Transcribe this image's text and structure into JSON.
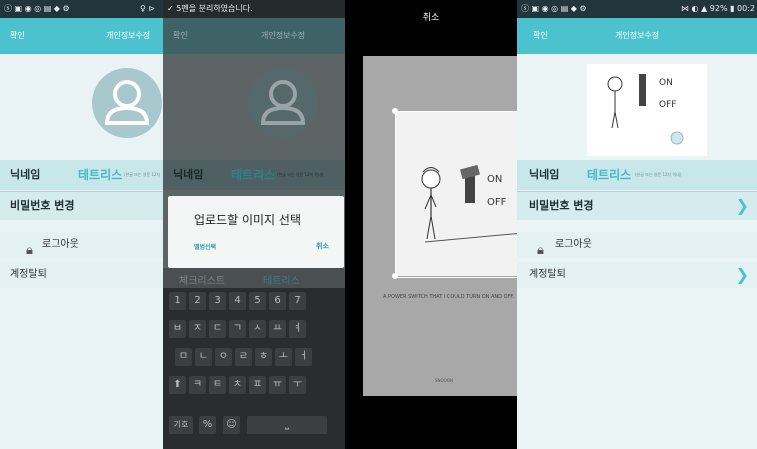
{
  "screen1": {
    "status_left": "ⓢ ▣ ◉ ◎ ▤ ◆ ⚙",
    "status_right": "♀ ⊳",
    "confirm": "확인",
    "title": "개인정보수정",
    "nickname_label": "닉네임",
    "nickname_value": "테트리스",
    "nickname_hint": "(한글 또는 영문 12자 이내)",
    "password_label": "비밀번호 변경",
    "logout_label": "로그아웃",
    "withdraw_label": "계정탈퇴"
  },
  "screen2": {
    "status_text": "✓ 5펜을 분리하였습니다.",
    "confirm": "확인",
    "title": "개인정보수정",
    "nickname_label": "닉네임",
    "nickname_value": "테트리스",
    "nickname_hint": "(한글 또는 영문 12자 이내)",
    "dialog_title": "업로드할 이미지 선택",
    "dialog_album": "앨범선택",
    "dialog_cancel": "취소",
    "input_ghost": "체크리스트",
    "input_value": "테트리스",
    "number_keys": [
      "1",
      "2",
      "3",
      "4",
      "5",
      "6",
      "7"
    ],
    "row1_keys": [
      "ㅂ",
      "ㅈ",
      "ㄷ",
      "ㄱ",
      "ㅅ",
      "ㅛ",
      "ㅕ"
    ],
    "row2_keys": [
      "ㅁ",
      "ㄴ",
      "ㅇ",
      "ㄹ",
      "ㅎ",
      "ㅗ",
      "ㅓ"
    ],
    "row3_keys": [
      "⬆",
      "ㅋ",
      "ㅌ",
      "ㅊ",
      "ㅍ",
      "ㅠ",
      "ㅜ"
    ],
    "bottom_keys": [
      "기호",
      "%",
      "☺"
    ]
  },
  "screen3": {
    "cancel": "취소",
    "on_text": "ON",
    "off_text": "OFF",
    "caption": "A POWER SWITCH THAT I COULD TURN ON AND OFF.",
    "credit": "SNOOON"
  },
  "screen4": {
    "status_left": "ⓢ ▣ ◉ ◎ ▤ ◆ ⚙",
    "status_right": "⋈ ◐ ▲ 92% ▮ 00:2",
    "confirm": "확인",
    "title": "개인정보수정",
    "on_text": "ON",
    "off_text": "OFF",
    "nickname_label": "닉네임",
    "nickname_value": "테트리스",
    "nickname_hint": "(한글 또는 영문 12자 이내)",
    "password_label": "비밀번호 변경",
    "logout_label": "로그아웃",
    "withdraw_label": "계정탈퇴"
  },
  "colors": {
    "accent": "#4cc2cf",
    "statusbar": "#22353b"
  }
}
